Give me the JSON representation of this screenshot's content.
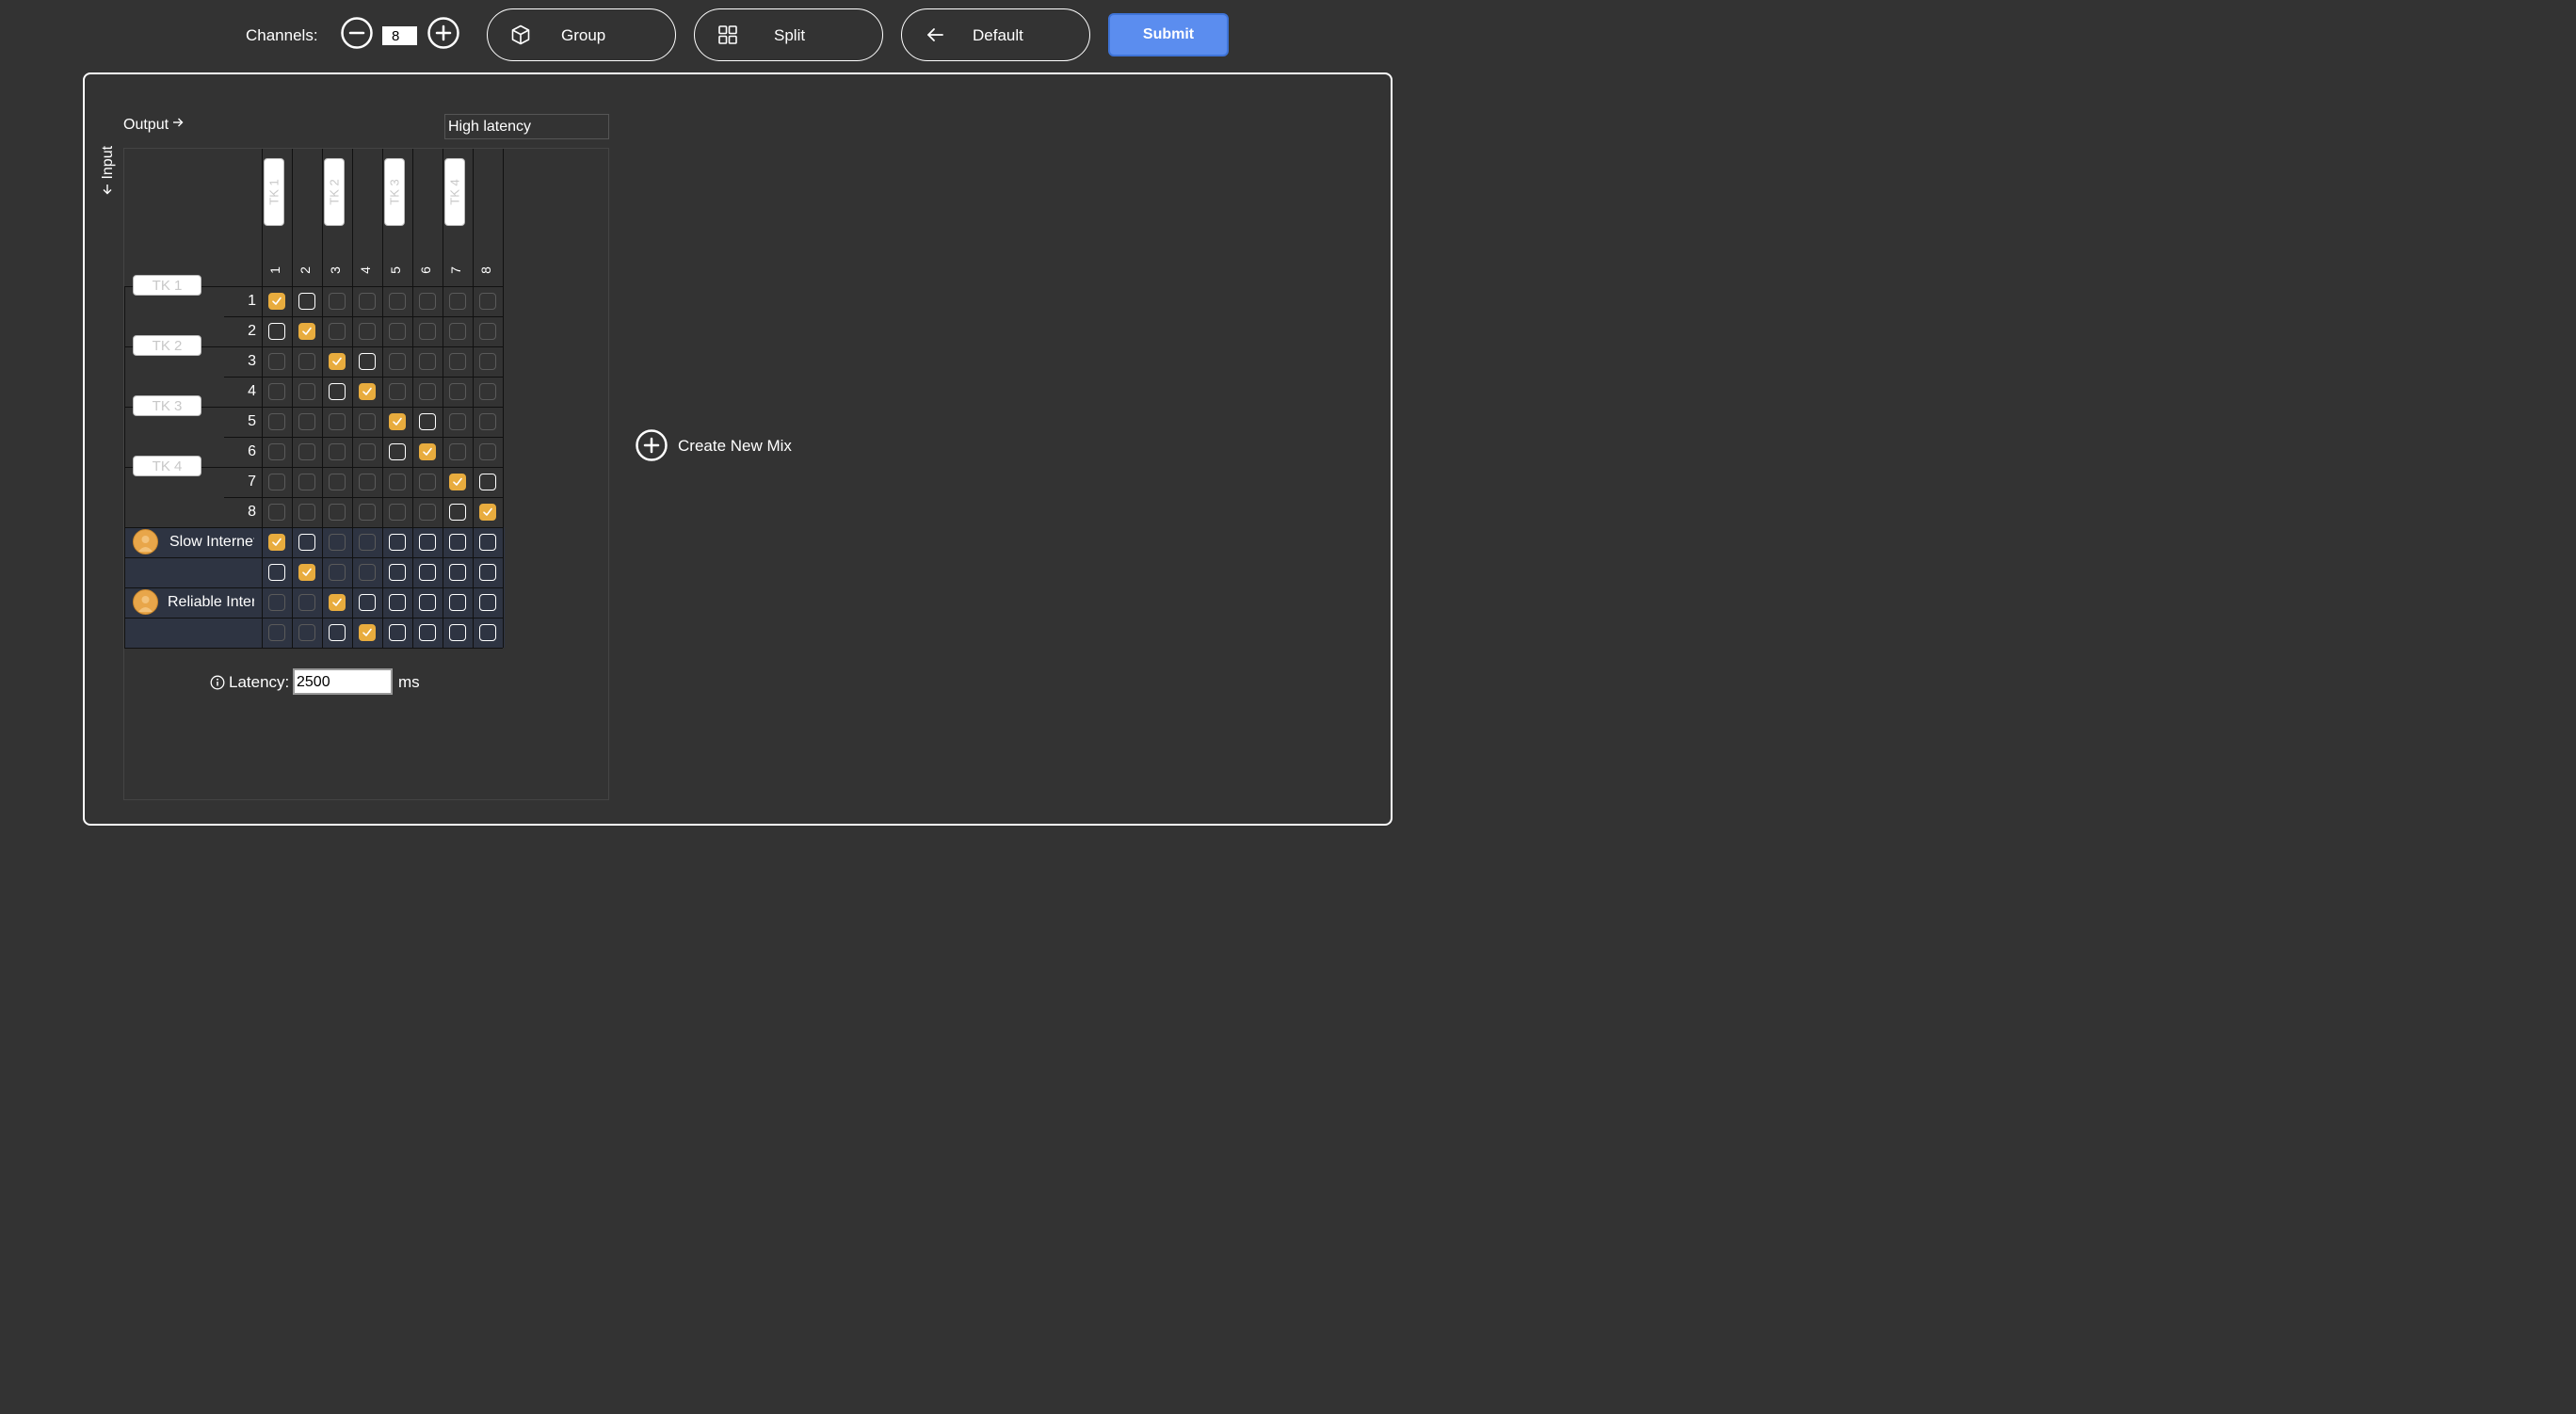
{
  "toolbar": {
    "channels_label": "Channels:",
    "channels_value": "8",
    "group_label": "Group",
    "split_label": "Split",
    "default_label": "Default",
    "submit_label": "Submit"
  },
  "matrix": {
    "output_label": "Output",
    "input_label": "Input",
    "latency_mode": "High latency",
    "column_groups": [
      "TK 1",
      "TK 2",
      "TK 3",
      "TK 4"
    ],
    "column_numbers": [
      "1",
      "2",
      "3",
      "4",
      "5",
      "6",
      "7",
      "8"
    ],
    "row_groups": [
      "TK 1",
      "TK 2",
      "TK 3",
      "TK 4"
    ],
    "row_numbers": [
      "1",
      "2",
      "3",
      "4",
      "5",
      "6",
      "7",
      "8"
    ],
    "streams": [
      {
        "name": "Slow Internet"
      },
      {
        "name": "Reliable Internet"
      }
    ],
    "accent_color": "#e8ac3e",
    "cells": [
      [
        "checked",
        "active",
        "dim",
        "dim",
        "dim",
        "dim",
        "dim",
        "dim"
      ],
      [
        "active",
        "checked",
        "dim",
        "dim",
        "dim",
        "dim",
        "dim",
        "dim"
      ],
      [
        "dim",
        "dim",
        "checked",
        "active",
        "dim",
        "dim",
        "dim",
        "dim"
      ],
      [
        "dim",
        "dim",
        "active",
        "checked",
        "dim",
        "dim",
        "dim",
        "dim"
      ],
      [
        "dim",
        "dim",
        "dim",
        "dim",
        "checked",
        "active",
        "dim",
        "dim"
      ],
      [
        "dim",
        "dim",
        "dim",
        "dim",
        "active",
        "checked",
        "dim",
        "dim"
      ],
      [
        "dim",
        "dim",
        "dim",
        "dim",
        "dim",
        "dim",
        "checked",
        "active"
      ],
      [
        "dim",
        "dim",
        "dim",
        "dim",
        "dim",
        "dim",
        "active",
        "checked"
      ],
      [
        "checked",
        "active",
        "dim",
        "dim",
        "active",
        "active",
        "active",
        "active"
      ],
      [
        "active",
        "checked",
        "dim",
        "dim",
        "active",
        "active",
        "active",
        "active"
      ],
      [
        "dim",
        "dim",
        "checked",
        "active",
        "active",
        "active",
        "active",
        "active"
      ],
      [
        "dim",
        "dim",
        "active",
        "checked",
        "active",
        "active",
        "active",
        "active"
      ]
    ]
  },
  "latency": {
    "label": "Latency:",
    "value": "2500",
    "unit": "ms"
  },
  "create_mix_label": "Create New Mix"
}
